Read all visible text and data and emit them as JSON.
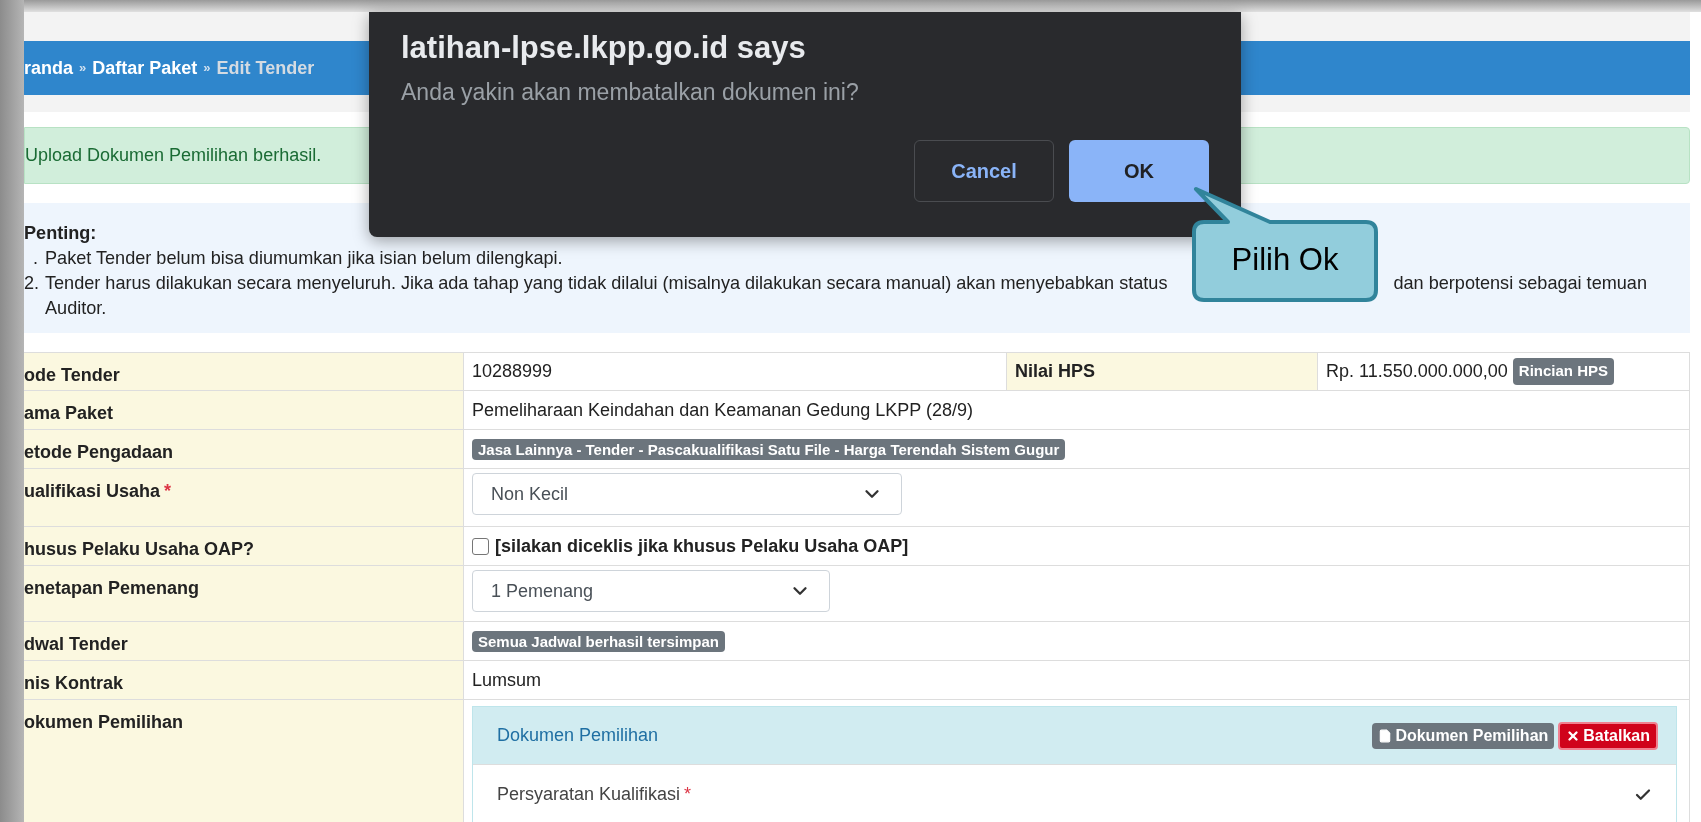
{
  "breadcrumb": {
    "separator": "»",
    "items": [
      {
        "label": "randa",
        "current": false
      },
      {
        "label": "Daftar Paket",
        "current": false
      },
      {
        "label": "Edit Tender",
        "current": true
      }
    ]
  },
  "alert": {
    "text": "Upload Dokumen Pemilihan berhasil."
  },
  "notice": {
    "title": "Penting:",
    "items": [
      {
        "number": ".",
        "text": "Paket Tender belum bisa diumumkan jika isian belum dilengkapi."
      },
      {
        "number": "2.",
        "text": "Tender harus dilakukan secara menyeluruh. Jika ada tahap yang tidak dilalui (misalnya dilakukan secara manual) akan menyebabkan status",
        "continuation": "dan berpotensi sebagai temuan Auditor."
      }
    ]
  },
  "table": {
    "rows": [
      {
        "label": "ode Tender",
        "kind": "text",
        "value": "10288999",
        "extra": {
          "label": "Nilai HPS",
          "value": "Rp. 11.550.000.000,00",
          "badge": "Rincian HPS"
        }
      },
      {
        "label": "ama Paket",
        "kind": "text",
        "value": "Pemeliharaan Keindahan dan Keamanan Gedung LKPP (28/9)"
      },
      {
        "label": "etode Pengadaan",
        "kind": "badge",
        "value": "Jasa Lainnya - Tender - Pascakualifikasi Satu File - Harga Terendah Sistem Gugur"
      },
      {
        "label": "ualifikasi Usaha",
        "required_mark": "*",
        "kind": "select",
        "value": "Non Kecil"
      },
      {
        "label": "husus Pelaku Usaha OAP?",
        "kind": "checkbox",
        "value": "[silakan diceklis jika khusus Pelaku Usaha OAP]",
        "checked": false
      },
      {
        "label": "enetapan Pemenang",
        "kind": "select",
        "value": "1 Pemenang"
      },
      {
        "label": "dwal Tender",
        "kind": "badge",
        "value": "Semua Jadwal berhasil tersimpan"
      },
      {
        "label": "nis Kontrak",
        "kind": "text",
        "value": "Lumsum"
      },
      {
        "label": "okumen Pemilihan",
        "kind": "documents",
        "panel": {
          "title": "Dokumen Pemilihan",
          "buttons": [
            {
              "kind": "file",
              "label": "Dokumen Pemilihan"
            },
            {
              "kind": "cancel",
              "label": "Batalkan"
            }
          ],
          "items": [
            {
              "label": "Persyaratan Kualifikasi",
              "required_mark": "*",
              "checked": true
            }
          ]
        }
      }
    ]
  },
  "dialog": {
    "title": "latihan-lpse.lkpp.go.id says",
    "message": "Anda yakin akan membatalkan dokumen ini?",
    "buttons": [
      {
        "label": "Cancel",
        "primary": false
      },
      {
        "label": "OK",
        "primary": true
      }
    ]
  },
  "callout": {
    "text": "Pilih Ok"
  }
}
